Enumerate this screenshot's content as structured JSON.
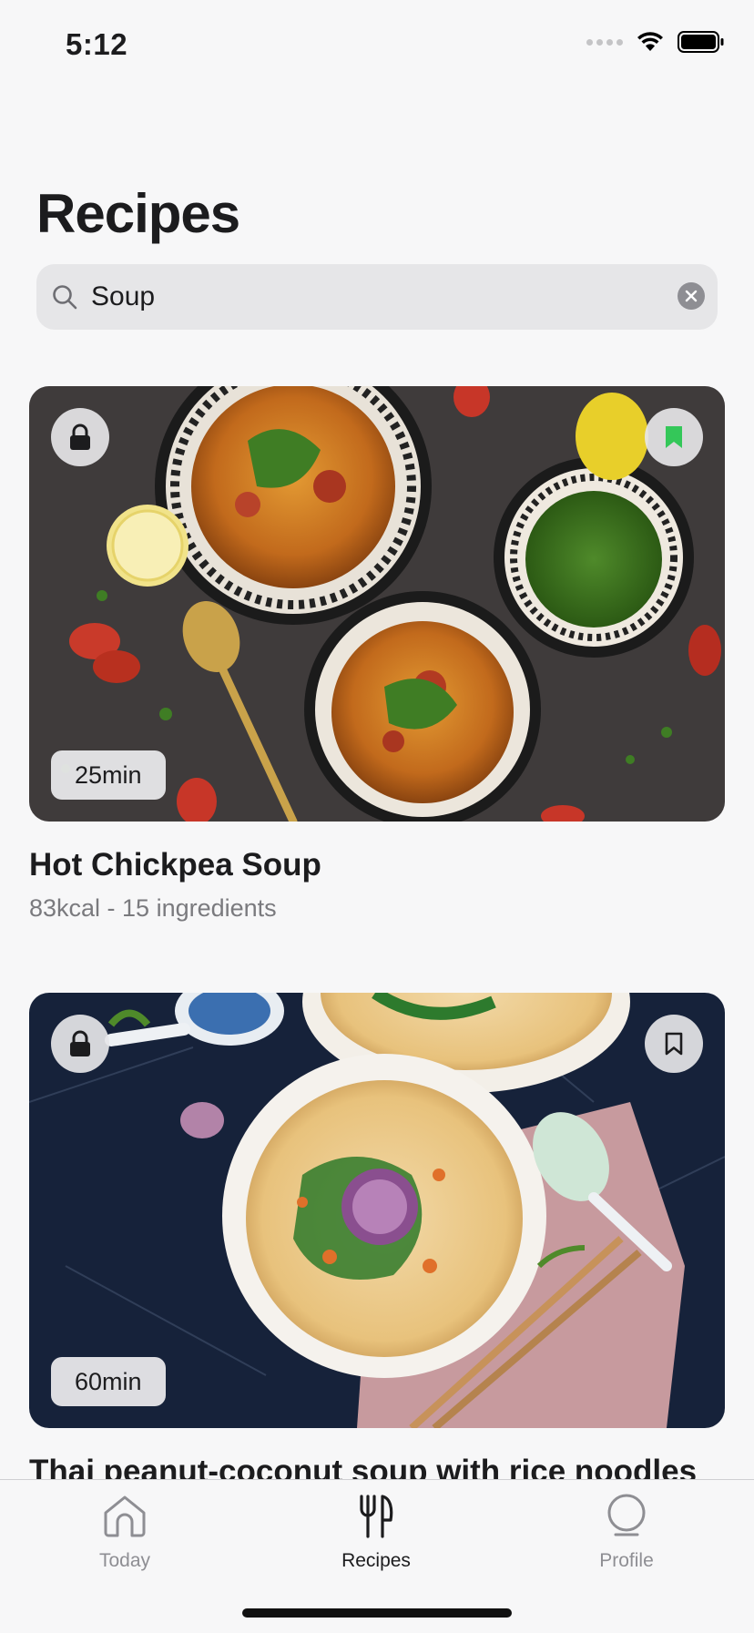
{
  "status": {
    "time": "5:12"
  },
  "page": {
    "title": "Recipes"
  },
  "search": {
    "value": "Soup",
    "placeholder": "Search"
  },
  "recipes": [
    {
      "duration": "25min",
      "title": "Hot Chickpea Soup",
      "meta": "83kcal - 15 ingredients",
      "bookmarked": true
    },
    {
      "duration": "60min",
      "title": "Thai peanut-coconut soup with rice noodles",
      "meta": "",
      "bookmarked": false
    }
  ],
  "tabs": [
    {
      "label": "Today",
      "icon": "house-icon",
      "active": false
    },
    {
      "label": "Recipes",
      "icon": "fork-knife-icon",
      "active": true
    },
    {
      "label": "Profile",
      "icon": "profile-icon",
      "active": false
    }
  ],
  "colors": {
    "accent": "#34c759",
    "background": "#f7f7f8",
    "search_bg": "#e6e6e8"
  }
}
